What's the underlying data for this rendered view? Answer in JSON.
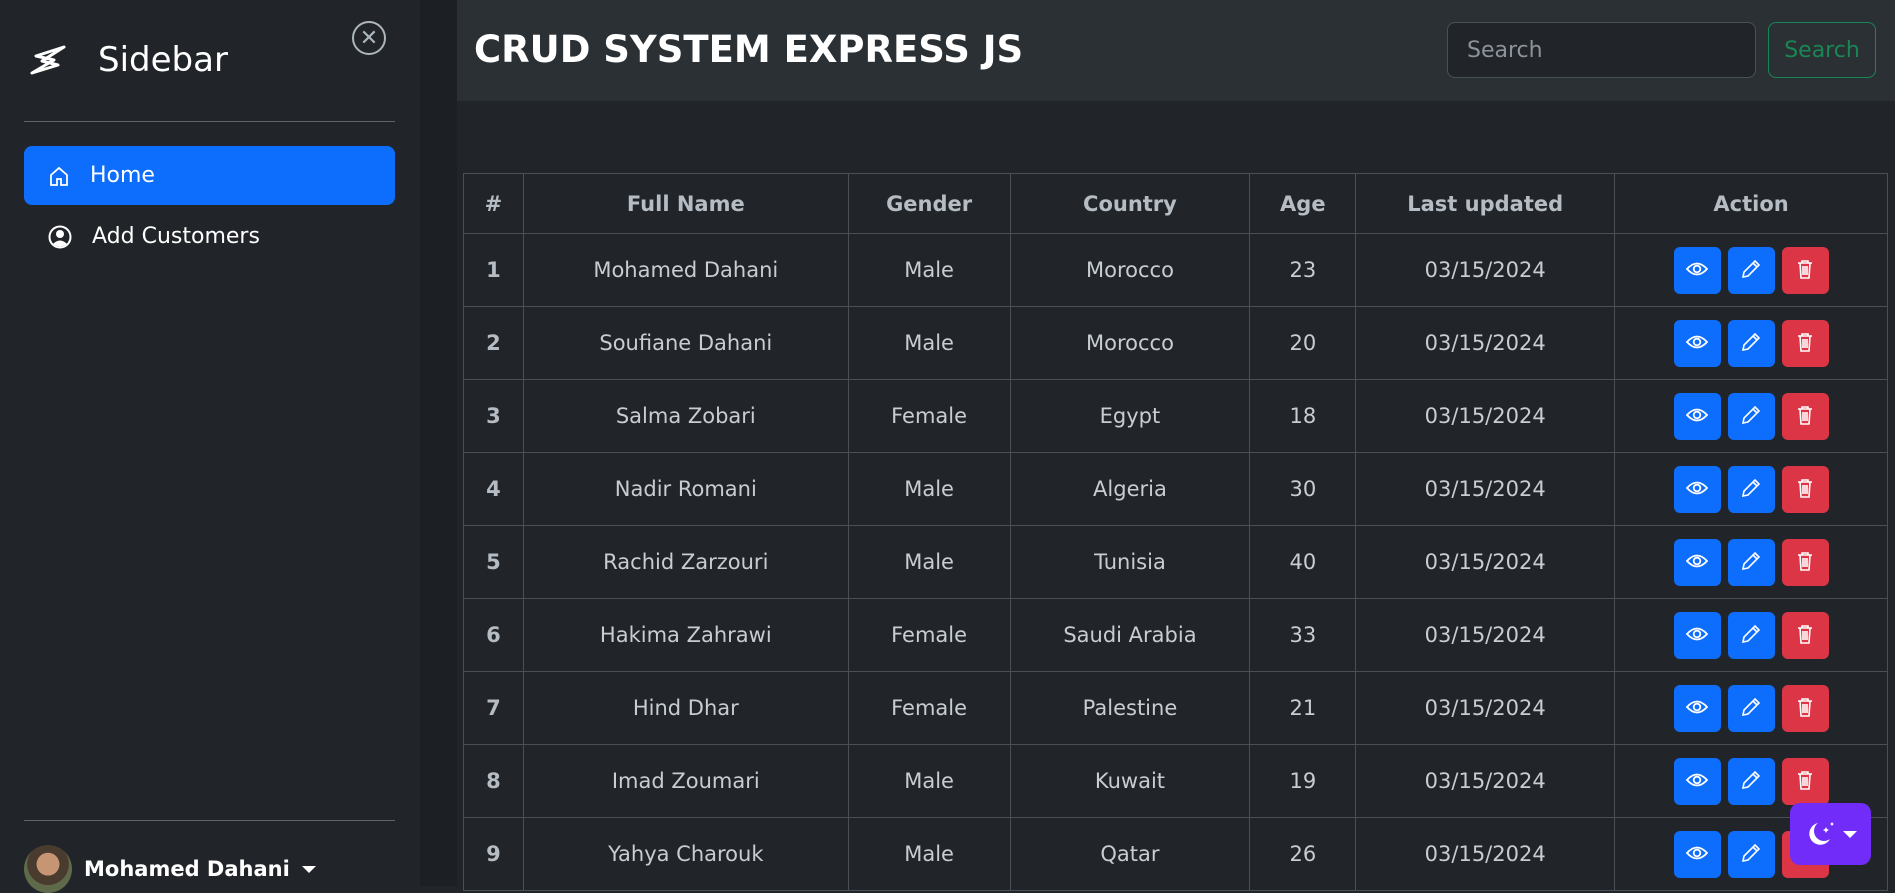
{
  "sidebar": {
    "brand": "Sidebar",
    "items": [
      {
        "label": "Home",
        "icon": "house-icon",
        "active": true
      },
      {
        "label": "Add Customers",
        "icon": "person-circle-icon",
        "active": false
      }
    ],
    "user": {
      "name": "Mohamed Dahani"
    }
  },
  "header": {
    "title": "CRUD SYSTEM EXPRESS JS",
    "search_placeholder": "Search",
    "search_button": "Search"
  },
  "table": {
    "columns": [
      "#",
      "Full Name",
      "Gender",
      "Country",
      "Age",
      "Last updated",
      "Action"
    ],
    "rows": [
      [
        "1",
        "Mohamed Dahani",
        "Male",
        "Morocco",
        "23",
        "03/15/2024"
      ],
      [
        "2",
        "Soufiane Dahani",
        "Male",
        "Morocco",
        "20",
        "03/15/2024"
      ],
      [
        "3",
        "Salma Zobari",
        "Female",
        "Egypt",
        "18",
        "03/15/2024"
      ],
      [
        "4",
        "Nadir Romani",
        "Male",
        "Algeria",
        "30",
        "03/15/2024"
      ],
      [
        "5",
        "Rachid Zarzouri",
        "Male",
        "Tunisia",
        "40",
        "03/15/2024"
      ],
      [
        "6",
        "Hakima Zahrawi",
        "Female",
        "Saudi Arabia",
        "33",
        "03/15/2024"
      ],
      [
        "7",
        "Hind Dhar",
        "Female",
        "Palestine",
        "21",
        "03/15/2024"
      ],
      [
        "8",
        "Imad Zoumari",
        "Male",
        "Kuwait",
        "19",
        "03/15/2024"
      ],
      [
        "9",
        "Yahya Charouk",
        "Male",
        "Qatar",
        "26",
        "03/15/2024"
      ]
    ]
  },
  "colors": {
    "primary": "#0d6efd",
    "danger": "#dc3545",
    "success": "#198754",
    "theme_toggle": "#712cf9",
    "background": "#212529",
    "header": "#2b3035"
  }
}
